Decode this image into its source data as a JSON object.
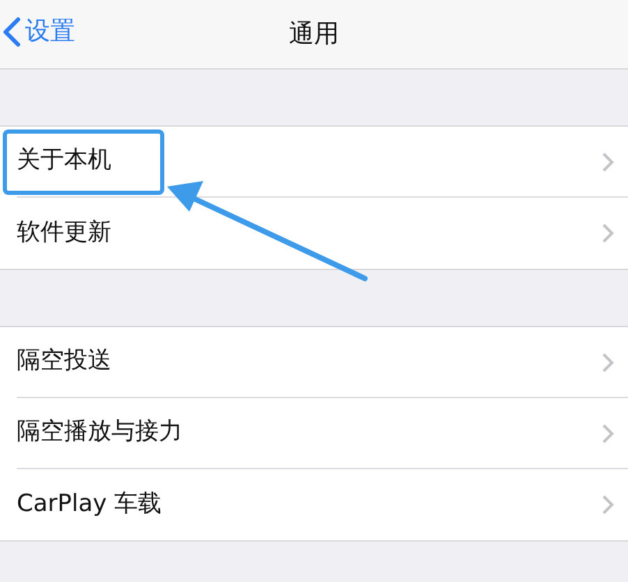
{
  "nav": {
    "back": "设置",
    "title": "通用"
  },
  "groups": [
    {
      "rows": [
        {
          "label": "关于本机",
          "highlighted": true
        },
        {
          "label": "软件更新",
          "highlighted": false
        }
      ]
    },
    {
      "rows": [
        {
          "label": "隔空投送",
          "highlighted": false
        },
        {
          "label": "隔空播放与接力",
          "highlighted": false
        },
        {
          "label": "CarPlay 车载",
          "highlighted": false
        }
      ]
    }
  ]
}
